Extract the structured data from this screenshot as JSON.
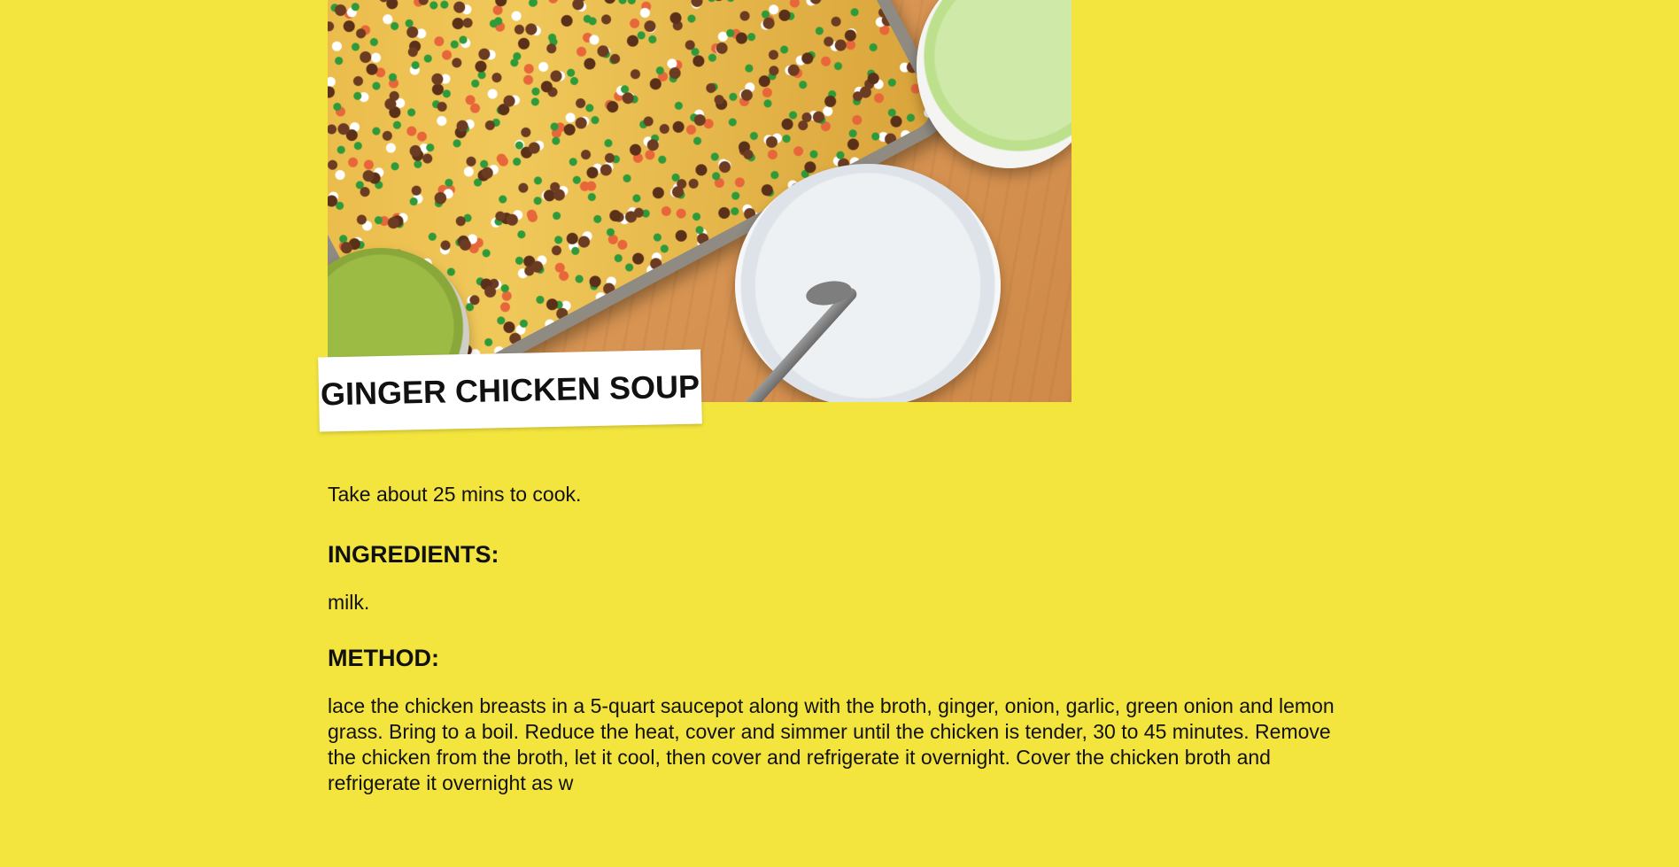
{
  "recipe": {
    "title": "GINGER CHICKEN SOUP",
    "cook_time": "Take about 25 mins to cook.",
    "ingredients_heading": "INGREDIENTS:",
    "ingredients_text": "milk.",
    "method_heading": "METHOD:",
    "method_text": "lace the chicken breasts in a 5-quart saucepot along with the broth, ginger, onion, garlic, green onion and lemon grass. Bring to a boil. Reduce the heat, cover and simmer until the chicken is tender, 30 to 45 minutes. Remove the chicken from the broth, let it cool, then cover and refrigerate it overnight. Cover the chicken broth and refrigerate it overnight as w"
  },
  "colors": {
    "background": "#f3e53e",
    "card": "#ffffff",
    "text": "#111111"
  },
  "hero_image": {
    "subject": "nachos-tray-with-bowls"
  }
}
